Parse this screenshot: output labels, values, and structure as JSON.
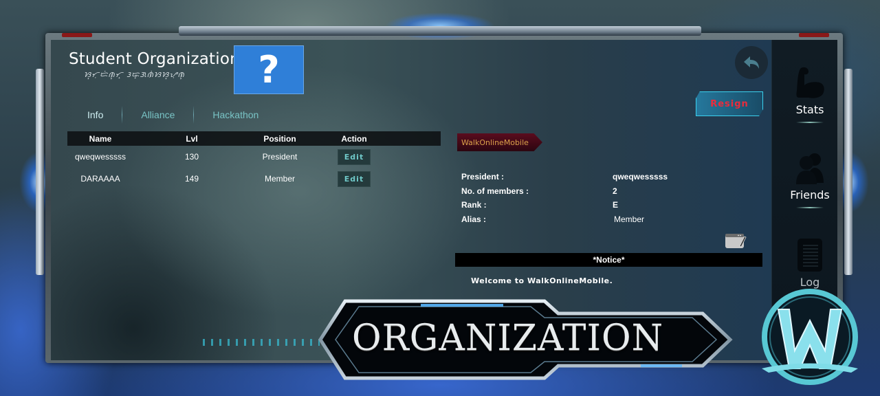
{
  "organization": {
    "name": "Student Organization",
    "subtitle": "ᜐ᜔ᜆᜓᜇᜒᜈ᜔ᜆ᜔ ᜂᜍ᜔ᜄᜈᜒᜐᜐ᜔ᜌᜓᜈ᜔",
    "logo_placeholder": "?"
  },
  "tabs": [
    {
      "label": "Info",
      "active": true
    },
    {
      "label": "Alliance",
      "active": false
    },
    {
      "label": "Hackathon",
      "active": false
    }
  ],
  "members_table": {
    "headers": [
      "Name",
      "Lvl",
      "Position",
      "Action"
    ],
    "rows": [
      {
        "name": "qweqwesssss",
        "lvl": "130",
        "position": "President",
        "action": "Edit"
      },
      {
        "name": "DARAAAA",
        "lvl": "149",
        "position": "Member",
        "action": "Edit"
      }
    ]
  },
  "actions": {
    "back_icon": "back-arrow-icon",
    "resign_label": "Resign"
  },
  "org_info": {
    "banner_label": "WalkOnlineMobile",
    "fields": [
      {
        "label": "President :",
        "value": "qweqwesssss"
      },
      {
        "label": "No. of members :",
        "value": "2"
      },
      {
        "label": "Rank :",
        "value": "E"
      },
      {
        "label": "Alias :",
        "value": "Member"
      }
    ],
    "notice_title": "*Notice*",
    "notice_text": "Welcome to WalkOnlineMobile."
  },
  "sidebar": {
    "items": [
      {
        "label": "Stats",
        "icon": "muscle-arm-icon"
      },
      {
        "label": "Friends",
        "icon": "friends-icon"
      },
      {
        "label": "Log",
        "icon": "notebook-icon"
      }
    ]
  },
  "screen_title": "ORGANIZATION",
  "colors": {
    "tab_text": "#79c4c6",
    "resign_text": "#ec2b3c",
    "banner_text": "#d9a24a",
    "logo_bg": "#2f7fd8",
    "edit_text": "#6fc8c8"
  }
}
